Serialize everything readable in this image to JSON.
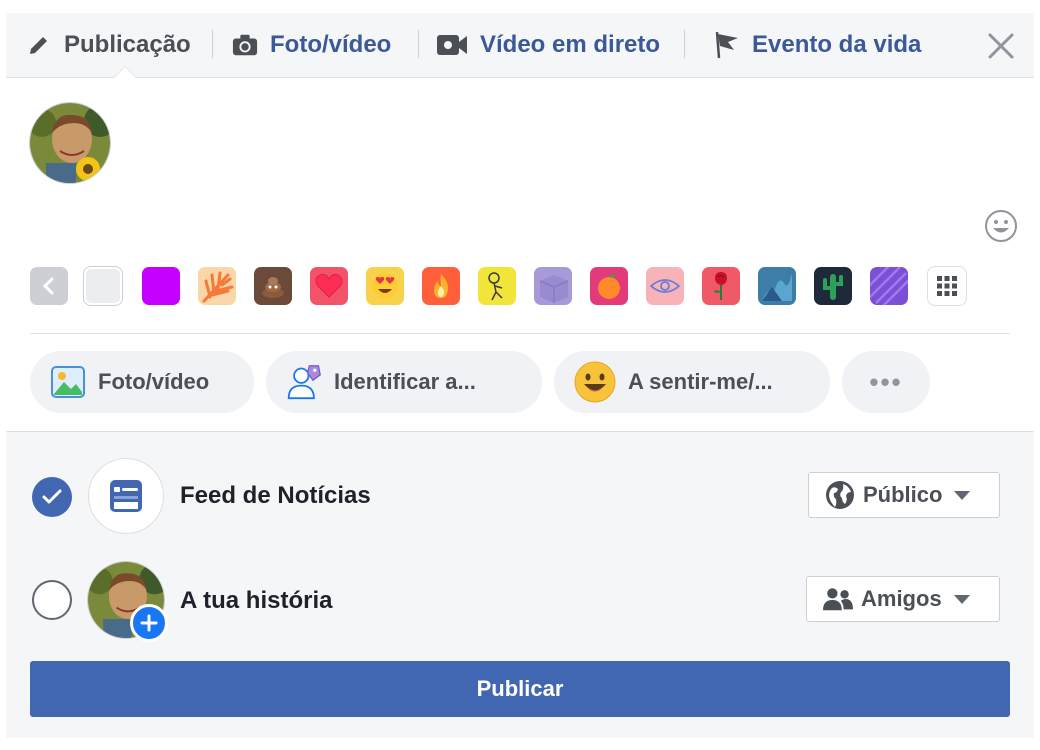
{
  "tabs": [
    {
      "label": "Publicação",
      "icon": "pencil-icon"
    },
    {
      "label": "Foto/vídeo",
      "icon": "camera-icon"
    },
    {
      "label": "Vídeo em direto",
      "icon": "video-camera-icon"
    },
    {
      "label": "Evento da vida",
      "icon": "flag-icon"
    }
  ],
  "backgrounds": {
    "items": [
      {
        "name": "plain-white",
        "color": "#ebedf0"
      },
      {
        "name": "solid-purple",
        "color": "#c600ff"
      },
      {
        "name": "peach-leaves",
        "color": "#fbd6a8"
      },
      {
        "name": "poop-emoji",
        "color": "#6b4a3a"
      },
      {
        "name": "heart",
        "color": "#f35369"
      },
      {
        "name": "heart-eyes",
        "color": "#f7515f"
      },
      {
        "name": "fire",
        "color": "#ff5f3a"
      },
      {
        "name": "yellow-doodle",
        "color": "#f2e53a"
      },
      {
        "name": "lavender-cube",
        "color": "#a89ad9"
      },
      {
        "name": "orange-fruit",
        "color": "#e23a7a"
      },
      {
        "name": "pink-eye",
        "color": "#f7b3b8"
      },
      {
        "name": "rose",
        "color": "#f05a68"
      },
      {
        "name": "blue-abstract",
        "color": "#3d7ea6"
      },
      {
        "name": "cactus-night",
        "color": "#1e2a3a"
      },
      {
        "name": "purple-lines",
        "color": "#7b4fd6"
      }
    ]
  },
  "actions": [
    {
      "label": "Foto/vídeo",
      "icon": "photo-icon"
    },
    {
      "label": "Identificar a...",
      "icon": "tag-people-icon"
    },
    {
      "label": "A sentir-me/...",
      "icon": "smiley-icon"
    },
    {
      "label": "•••",
      "icon": "more-icon"
    }
  ],
  "targets": {
    "feed": {
      "label": "Feed de Notícias",
      "checked": true,
      "audience": "Público"
    },
    "story": {
      "label": "A tua história",
      "checked": false,
      "audience": "Amigos"
    }
  },
  "publish_label": "Publicar",
  "colors": {
    "accent": "#4267b2",
    "tab_blue": "#3b5998",
    "check_blue": "#4267b2"
  }
}
